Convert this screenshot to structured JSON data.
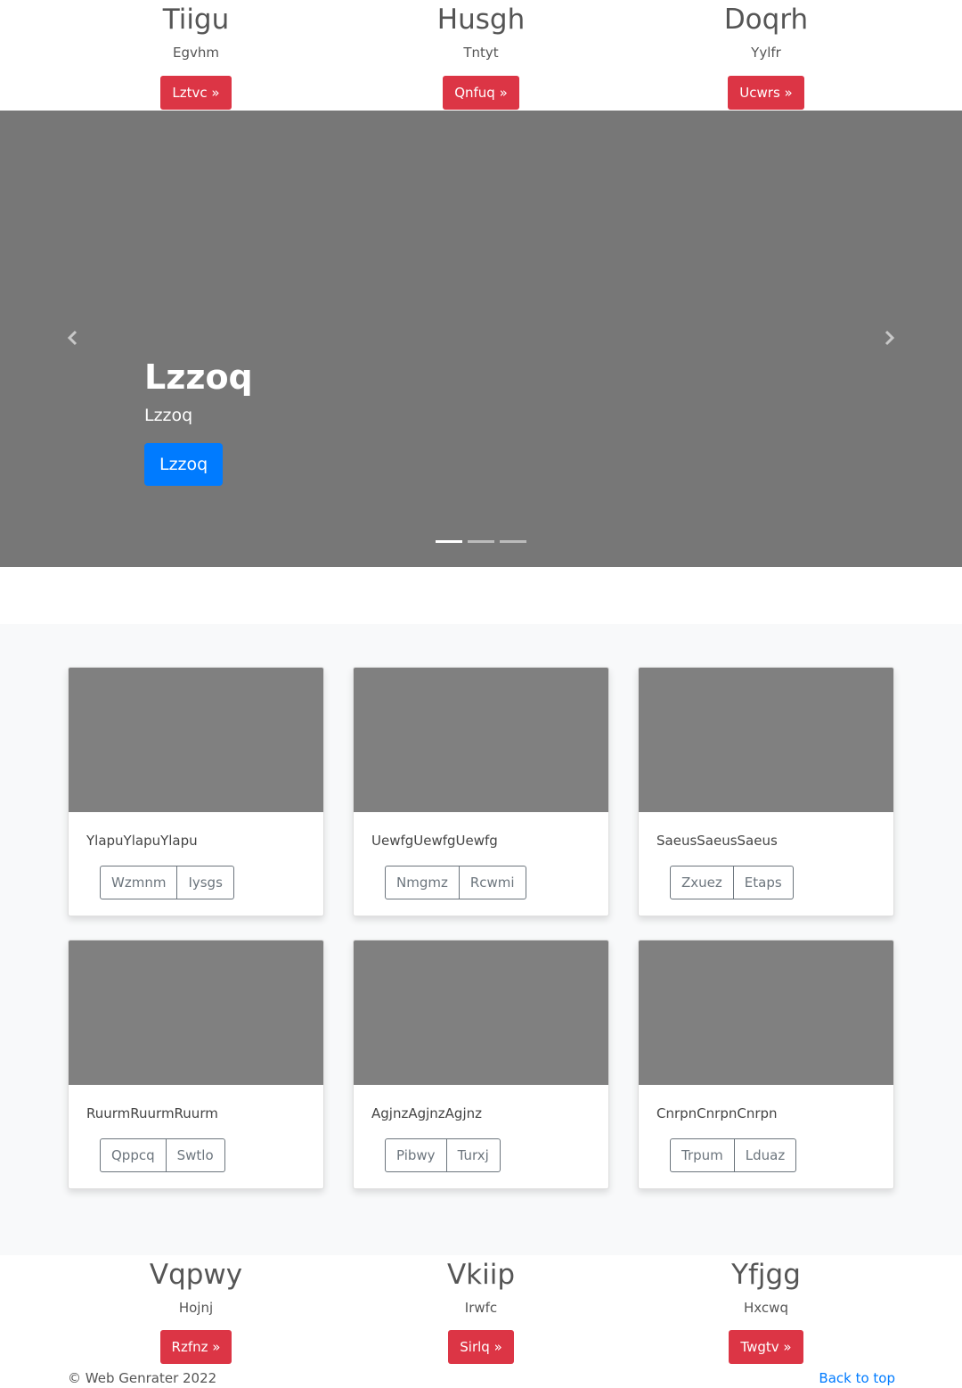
{
  "top_features": [
    {
      "title": "Tiigu",
      "subtitle": "Egvhm",
      "button": "Lztvc »"
    },
    {
      "title": "Husgh",
      "subtitle": "Tntyt",
      "button": "Qnfuq »"
    },
    {
      "title": "Doqrh",
      "subtitle": "Yylfr",
      "button": "Ucwrs »"
    }
  ],
  "carousel": {
    "heading": "Lzzoq",
    "lead": "Lzzoq",
    "button": "Lzzoq",
    "prev_icon": "chevron-left-icon",
    "next_icon": "chevron-right-icon",
    "slide_count": 3,
    "active_slide": 1,
    "background_color": "#777777",
    "button_color": "#007bff"
  },
  "cards": [
    {
      "text": "YlapuYlapuYlapu",
      "buttons": [
        "Wzmnm",
        "Iysgs"
      ]
    },
    {
      "text": "UewfgUewfgUewfg",
      "buttons": [
        "Nmgmz",
        "Rcwmi"
      ]
    },
    {
      "text": "SaeusSaeusSaeus",
      "buttons": [
        "Zxuez",
        "Etaps"
      ]
    },
    {
      "text": "RuurmRuurmRuurm",
      "buttons": [
        "Qppcq",
        "Swtlo"
      ]
    },
    {
      "text": "AgjnzAgjnzAgjnz",
      "buttons": [
        "Pibwy",
        "Turxj"
      ]
    },
    {
      "text": "CnrpnCnrpnCnrpn",
      "buttons": [
        "Trpum",
        "Lduaz"
      ]
    }
  ],
  "bottom_features": [
    {
      "title": "Vqpwy",
      "subtitle": "Hojnj",
      "button": "Rzfnz »"
    },
    {
      "title": "Vkiip",
      "subtitle": "Irwfc",
      "button": "Sirlq »"
    },
    {
      "title": "Yfjgg",
      "subtitle": "Hxcwq",
      "button": "Twgtv »"
    }
  ],
  "footer": {
    "copyright": "© Web Genrater 2022",
    "back_to_top": "Back to top"
  },
  "colors": {
    "accent_red": "#dc3545",
    "link_blue": "#007bff",
    "placeholder_gray": "#808080"
  }
}
